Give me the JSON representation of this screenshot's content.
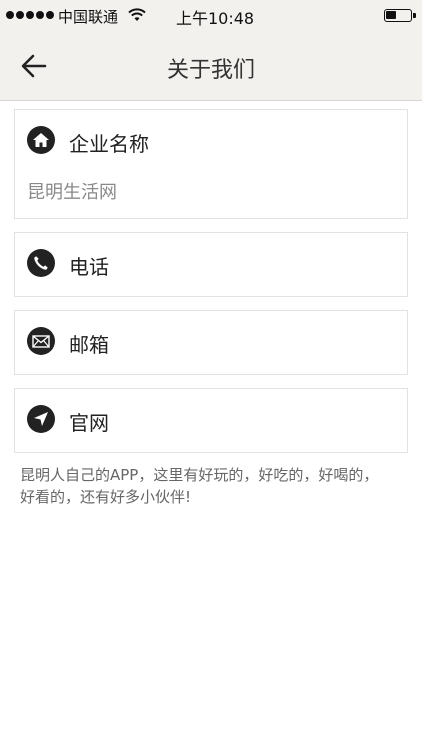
{
  "status_bar": {
    "carrier": "中国联通",
    "time": "上午10:48",
    "battery_level": 0.45
  },
  "nav": {
    "title": "关于我们"
  },
  "company": {
    "label": "企业名称",
    "value": "昆明生活网"
  },
  "phone": {
    "label": "电话"
  },
  "email": {
    "label": "邮箱"
  },
  "website": {
    "label": "官网"
  },
  "about": {
    "text": "昆明人自己的APP，这里有好玩的，好吃的，好喝的，好看的，还有好多小伙伴!"
  },
  "colors": {
    "header_bg": "#f3f1ee",
    "icon_bg": "#222222",
    "secondary_text": "#8a8a8a"
  }
}
